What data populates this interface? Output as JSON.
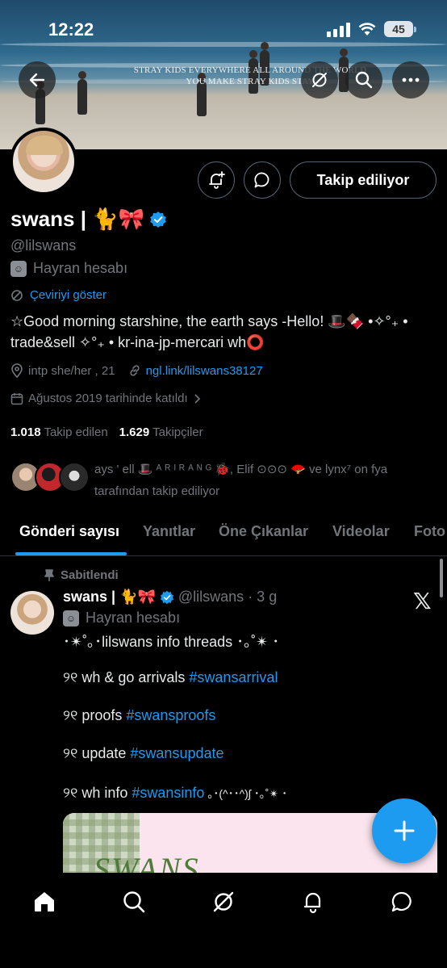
{
  "status_bar": {
    "time": "12:22",
    "battery": "45"
  },
  "banner": {
    "caption_line1": "STRAY KIDS EVERYWHERE ALL AROUND THE WORLD",
    "caption_line2": "YOU MAKE STRAY KIDS STAY"
  },
  "profile": {
    "display_name": "swans | 🐈🎀",
    "handle": "@lilswans",
    "label": "Hayran hesabı",
    "translate": "Çeviriyi göster",
    "bio_line1": "☆Good morning starshine, the earth says -Hello! 🎩🍫 •✧°₊ •",
    "bio_line2": "trade&sell ✧°₊ • kr-ina-jp-mercari wh⭕",
    "location": "intp she/her , 21",
    "link": "ngl.link/lilswans38127",
    "joined": "Ağustos 2019 tarihinde katıldı",
    "following_count": "1.018",
    "following_label": "Takip edilen",
    "followers_count": "1.629",
    "followers_label": "Takipçiler",
    "followed_by_line1": "ays ' ell 🎩 ᴬ ᴿ ᴵ ᴿ ᴬ ᴺ ᴳ 🐞, Elif ⊙⊙⊙ 🪭 ve lynx⁷ on fya",
    "followed_by_line2": "tarafından takip ediliyor",
    "follow_button": "Takip ediliyor"
  },
  "tabs": [
    {
      "label": "Gönderi sayısı",
      "active": true
    },
    {
      "label": "Yanıtlar"
    },
    {
      "label": "Öne Çıkanlar"
    },
    {
      "label": "Videolar"
    },
    {
      "label": "Foto"
    }
  ],
  "post": {
    "pinned_label": "Sabitlendi",
    "author": "swans | 🐈🎀",
    "handle": "@lilswans",
    "time": "· 3 g",
    "label": "Hayran hesabı",
    "line1": "･✴︎˚｡･lilswans info threads ･｡˚✴︎ ･",
    "items": [
      {
        "prefix": "୨୧ wh & go arrivals ",
        "tag": "#swansarrival",
        "suffix": ""
      },
      {
        "prefix": "୨୧ proofs ",
        "tag": "#swansproofs",
        "suffix": ""
      },
      {
        "prefix": "୨୧ update ",
        "tag": "#swansupdate",
        "suffix": ""
      },
      {
        "prefix": "୨୧ wh info ",
        "tag": "#swansinfo",
        "suffix": "   ｡･(^･･^)ʃ ･｡˚✴︎ ･"
      }
    ],
    "media_text": "SWANS"
  },
  "colors": {
    "accent": "#1d9bf0",
    "background": "#000000",
    "muted": "#71767b"
  }
}
